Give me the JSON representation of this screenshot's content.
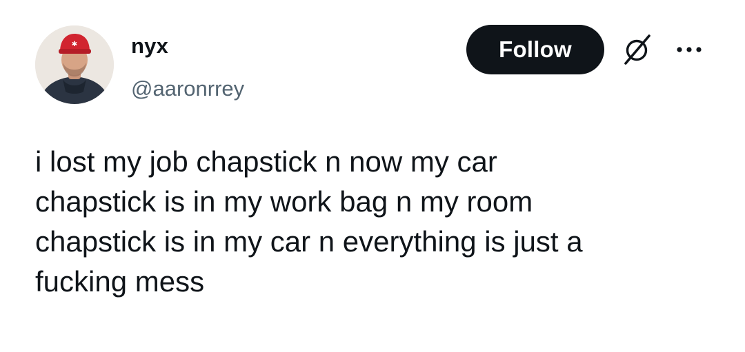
{
  "author": {
    "display_name": "nyx",
    "handle": "@aaronrrey",
    "avatar_icon": "profile-photo"
  },
  "actions": {
    "follow_label": "Follow",
    "grok_icon": "grok-icon",
    "more_icon": "more-icon"
  },
  "tweet": {
    "text": "i lost my job chapstick n now my car\nchapstick is in my work bag n my room\nchapstick is in my car n everything is just a\nfucking mess"
  },
  "colors": {
    "text_primary": "#0f1419",
    "text_secondary": "#536471",
    "button_bg": "#0f1419",
    "button_text": "#ffffff",
    "background": "#ffffff"
  }
}
